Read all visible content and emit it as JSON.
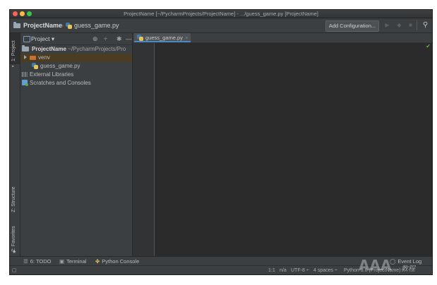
{
  "window": {
    "title": "ProjectName [~/PycharmProjects/ProjectName] - .../guess_game.py [ProjectName]"
  },
  "navbar": {
    "project": "ProjectName",
    "file": "guess_game.py",
    "config_button": "Add Configuration..."
  },
  "left_tool_tabs": [
    "1: Project",
    "Z: Structure",
    "2: Favorites"
  ],
  "project_panel": {
    "view_selector": "Project",
    "tree": {
      "root_name": "ProjectName",
      "root_path": "~/PycharmProjects/Pro",
      "venv": "venv",
      "file": "guess_game.py",
      "external": "External Libraries",
      "scratches": "Scratches and Consoles"
    }
  },
  "editor": {
    "tab_label": "guess_game.py"
  },
  "bottom_tabs": {
    "todo": "6: TODO",
    "terminal": "Terminal",
    "python_console": "Python Console",
    "event_log": "Event Log"
  },
  "status": {
    "position": "1:1",
    "na": "n/a",
    "encoding": "UTF-8 ÷",
    "indent": "4 spaces ÷",
    "interpreter": "Python 3.6 (ProjectName) ÷"
  },
  "watermark": {
    "text": "AAA",
    "script": "教程"
  },
  "colors": {
    "bg": "#2b2b2b",
    "panel": "#3c3f41",
    "selection": "#4b3d24",
    "accent": "#4a88c7"
  }
}
